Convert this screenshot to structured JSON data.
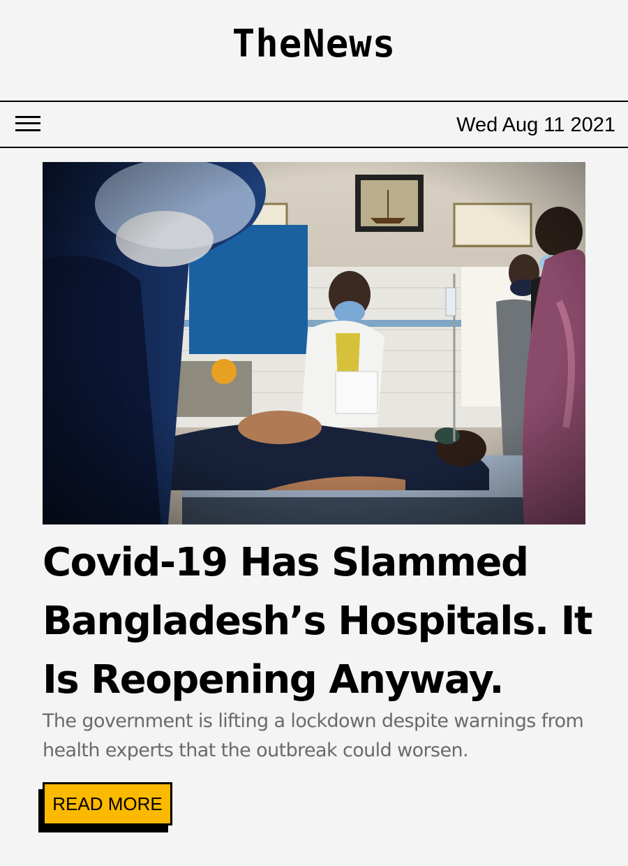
{
  "site": {
    "logo": "TheNews"
  },
  "navbar": {
    "menu_icon": "hamburger-menu-icon",
    "date": "Wed Aug 11 2021"
  },
  "article": {
    "image_description": "hospital-ward-photo",
    "headline": "Covid-19 Has Slammed Bangladesh’s Hospitals. It Is Reopening Anyway.",
    "dek": "The government is lifting a lockdown despite warnings from health experts that the outbreak could worsen.",
    "read_more_label": "READ MORE"
  },
  "colors": {
    "background": "#f4f4f4",
    "accent": "#fbb900",
    "dek_text": "#6a6a6a"
  }
}
